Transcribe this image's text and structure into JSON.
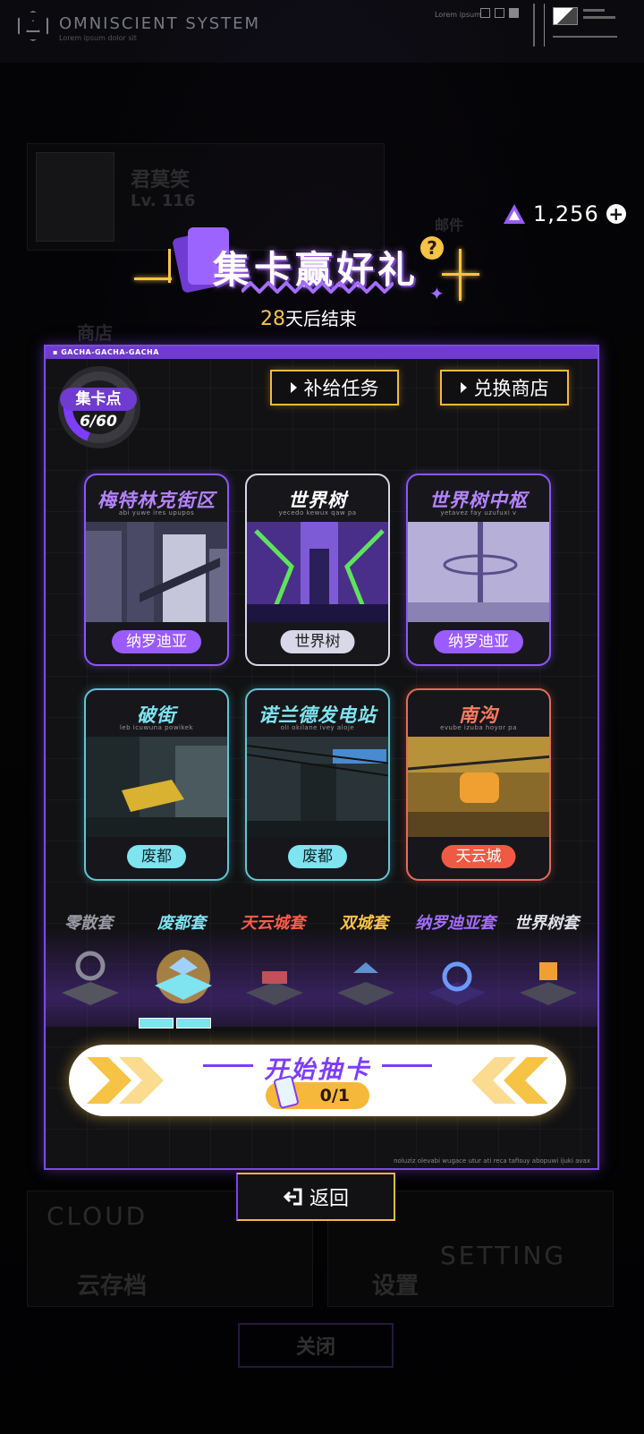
{
  "header": {
    "system_name": "OMNISCIENT SYSTEM",
    "system_sub": "Lorem ipsum dolor sit",
    "tiny_text": "Lorem ipsum"
  },
  "background": {
    "profile_name": "君莫笑",
    "profile_level": "Lv. 116",
    "mail_label": "邮件",
    "shop_label": "商店",
    "cloud_save": "云存档",
    "settings": "设置",
    "close": "关闭",
    "cloud_word": "CLOUD",
    "setting_word": "SETTING"
  },
  "currency": {
    "value": "1,256",
    "icon": "triangle-gem-icon",
    "add_icon": "plus-icon"
  },
  "event": {
    "title": "集卡赢好礼",
    "countdown_days": "28",
    "countdown_suffix": "天后结束"
  },
  "panel": {
    "tag": "GACHA-GACHA-GACHA",
    "footer": "noluziz olevabi wugace utur ati reca tafisuy abopuwi ijuki avax",
    "points_label": "集卡点",
    "points_value": "6/60",
    "points_progress": 0.1,
    "task_button": "补给任务",
    "shop_button": "兑换商店"
  },
  "cards": [
    {
      "title": "梅特林克街区",
      "sub": "abi yuwe ires upupos",
      "tag": "纳罗迪亚",
      "theme": "purple"
    },
    {
      "title": "世界树",
      "sub": "yecedo kewux qaw pa",
      "tag": "世界树",
      "theme": "white"
    },
    {
      "title": "世界树中枢",
      "sub": "yetavez fay uzufuxi v",
      "tag": "纳罗迪亚",
      "theme": "purple"
    },
    {
      "title": "破街",
      "sub": "leb icuwuna powikek",
      "tag": "废都",
      "theme": "cyan"
    },
    {
      "title": "诺兰德发电站",
      "sub": "oli okilane ivey aloje",
      "tag": "废都",
      "theme": "cyan"
    },
    {
      "title": "南沟",
      "sub": "evube izuba hoyor pa",
      "tag": "天云城",
      "theme": "red"
    }
  ],
  "sets": [
    {
      "label": "零散套",
      "color": "#9a9aa4"
    },
    {
      "label": "废都套",
      "color": "#7fe3f0",
      "progress_segments": 2
    },
    {
      "label": "天云城套",
      "color": "#ff5b48"
    },
    {
      "label": "双城套",
      "color": "#f6c344"
    },
    {
      "label": "纳罗迪亚套",
      "color": "#a46cff"
    },
    {
      "label": "世界树套",
      "color": "#e0e0ea"
    }
  ],
  "start": {
    "label": "开始抽卡",
    "tickets": "0/1"
  },
  "back": {
    "label": "返回"
  },
  "colors": {
    "accent_purple": "#7d3cff",
    "accent_gold": "#f6b83a",
    "cyan": "#7fe3f0",
    "red": "#f05a45"
  }
}
